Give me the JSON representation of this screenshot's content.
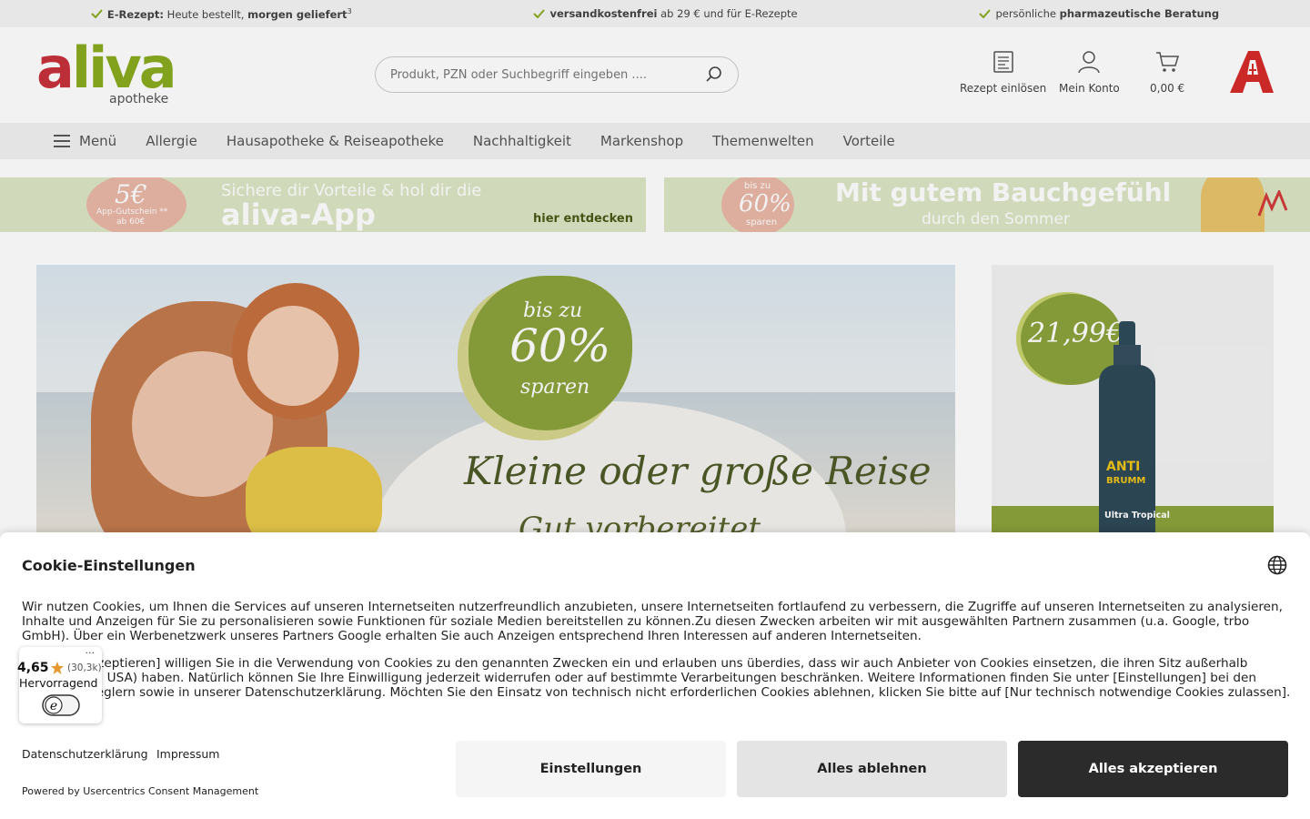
{
  "usp": {
    "item1_bold": "E-Rezept:",
    "item1_text": "Heute bestellt,",
    "item1_bold2": "morgen geliefert",
    "item1_sup": "3",
    "item2_bold": "versandkostenfrei",
    "item2_text": "ab 29 € und für E-Rezepte",
    "item3_text": "persönliche",
    "item3_bold": "pharmazeutische Beratung"
  },
  "header": {
    "logo_a": "a",
    "logo_rest": "liva",
    "logo_sub": "apotheke",
    "search_placeholder": "Produkt, PZN oder Suchbegriff eingeben ....",
    "rezept_label": "Rezept einlösen",
    "konto_label": "Mein Konto",
    "cart_label": "0,00 €"
  },
  "nav": {
    "menu_label": "Menü",
    "items": [
      "Allergie",
      "Hausapotheke & Reiseapotheke",
      "Nachhaltigkeit",
      "Markenshop",
      "Themenwelten",
      "Vorteile"
    ]
  },
  "promo_left": {
    "badge_big": "5€",
    "badge_small1": "App-Gutschein **",
    "badge_small2": "ab 60€",
    "line1": "Sichere dir Vorteile & hol dir die",
    "line2": "aliva-App",
    "cta": "hier entdecken"
  },
  "promo_right": {
    "badge_small1": "bis zu",
    "badge_big": "60%",
    "badge_small2": "sparen",
    "line1": "Mit gutem Bauchgefühl",
    "line2": "durch den Sommer"
  },
  "hero": {
    "badge_line1": "bis zu",
    "badge_line2": "60%",
    "badge_line3": "sparen",
    "headline": "Kleine oder große Reise",
    "subline": "Gut vorbereitet"
  },
  "hero_side": {
    "price": "21,99€",
    "product_brand1": "ANTI",
    "product_brand2": "BRUMM",
    "product_name": "Ultra Tropical"
  },
  "cookie": {
    "title": "Cookie-Einstellungen",
    "p1": "Wir nutzen Cookies, um Ihnen die Services auf unseren Internetseiten nutzerfreundlich anzubieten, unsere Internetseiten fortlaufend zu verbessern, die Zugriffe auf unseren Internetseiten zu analysieren, Inhalte und Anzeigen für Sie zu personalisieren sowie Funktionen für soziale Medien bereitstellen zu können.Zu diesen Zwecken arbeiten wir mit ausgewählten Partnern zusammen (u.a. Google, trbo GmbH). Über ein Werbenetzwerk unseres Partners Google erhalten Sie auch Anzeigen entsprechend Ihren Interessen auf anderen Internetseiten.",
    "p2": "Mit [Alles akzeptieren] willigen Sie in die Verwendung von Cookies zu den genannten Zwecken ein und erlauben uns überdies, dass wir auch Anbieter von Cookies einsetzen, die ihren Sitz außerhalb EU/EWR (z.B. USA) haben. Natürlich können Sie Ihre Einwilligung jederzeit widerrufen oder auf bestimmte Verarbeitungen beschränken. Weitere Informationen finden Sie unter [Einstellungen] bei den jeweiligen Reglern sowie in unserer Datenschutzerklärung. Möchten Sie den Einsatz von technisch nicht erforderlichen Cookies ablehnen, klicken Sie bitte auf [Nur technisch notwendige Cookies zulassen].",
    "link_privacy": "Datenschutzerklärung",
    "link_imprint": "Impressum",
    "powered": "Powered by Usercentrics Consent Management",
    "btn_settings": "Einstellungen",
    "btn_deny": "Alles ablehnen",
    "btn_accept": "Alles akzeptieren"
  },
  "trust": {
    "dots": "···",
    "score": "4,65",
    "count": "(30,3k)",
    "label": "Hervorragend",
    "e_letter": "e"
  },
  "colors": {
    "brand_red": "#c8323b",
    "brand_green": "#8aaa1f",
    "accept_bg": "#2b2b2b"
  }
}
